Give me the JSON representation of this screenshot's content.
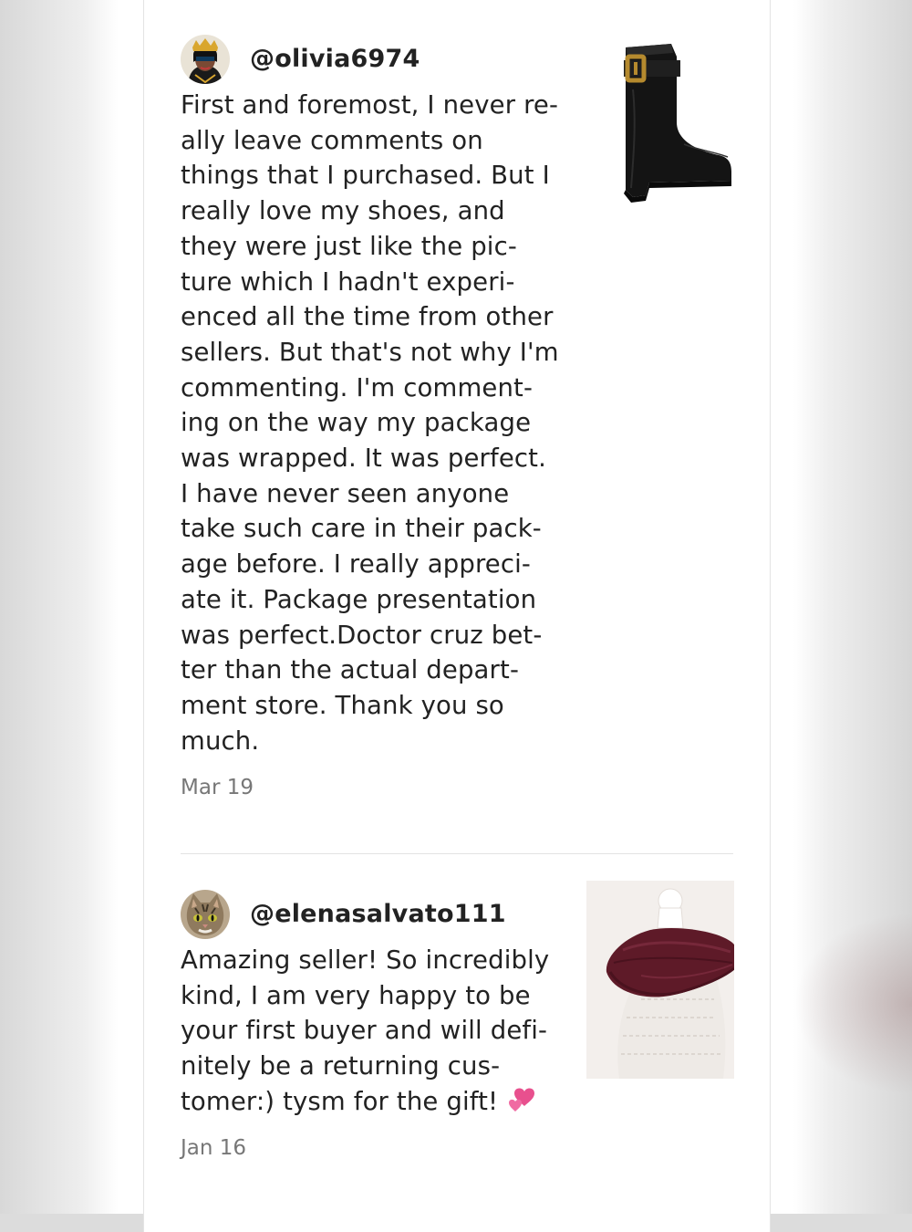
{
  "reviews": [
    {
      "username": "@olivia6974",
      "avatar_icon": "user-avatar-crowned-portrait-icon",
      "body": "First and foremost, I never re-\nally leave comments on\nthings that I purchased. But I\nreally love my shoes, and\nthey were just like the pic-\nture which I hadn't experi-\nenced all the time from other\nsellers. But that's not why I'm\ncommenting. I'm comment-\ning on the way my package\nwas wrapped. It was perfect.\nI have never seen anyone\ntake such care in their pack-\nage before. I really appreci-\nate it. Package presentation\nwas perfect.Doctor cruz bet-\nter than the actual depart-\nment store. Thank you so\nmuch.",
      "date": "Mar 19",
      "product_image": "black-leather-buckle-ankle-boot"
    },
    {
      "username": "@elenasalvato111",
      "avatar_icon": "user-avatar-tabby-cat-icon",
      "body": "Amazing seller! So incredibly\nkind, I am very happy to be\nyour first buyer and will defi-\nnitely be a returning cus-\ntomer:) tysm for the gift!",
      "emoji": "💕",
      "date": "Jan 16",
      "product_image": "burgundy-knit-infinity-scarf-on-mannequin"
    }
  ],
  "colors": {
    "text": "#222222",
    "muted": "#777777",
    "divider": "#e2e2e2",
    "heart_pink": "#e8508e"
  }
}
